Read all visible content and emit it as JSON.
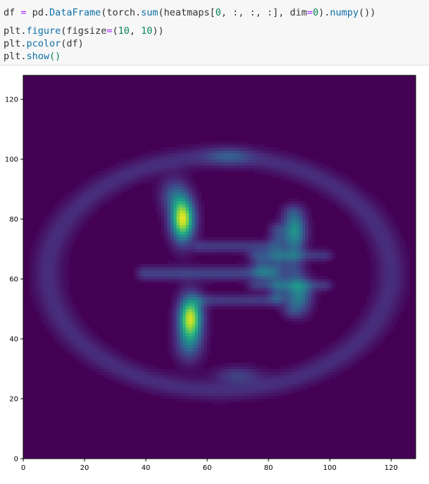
{
  "code": {
    "lines": [
      [
        {
          "t": "df ",
          "c": "def"
        },
        {
          "t": "=",
          "c": "op"
        },
        {
          "t": " pd.",
          "c": "def"
        },
        {
          "t": "DataFrame",
          "c": "fn"
        },
        {
          "t": "(torch.",
          "c": "def"
        },
        {
          "t": "sum",
          "c": "fn"
        },
        {
          "t": "(heatmaps[",
          "c": "def"
        },
        {
          "t": "0",
          "c": "num"
        },
        {
          "t": ", :, :, :], dim",
          "c": "def"
        },
        {
          "t": "=",
          "c": "op"
        },
        {
          "t": "0",
          "c": "num"
        },
        {
          "t": ").",
          "c": "def"
        },
        {
          "t": "numpy",
          "c": "fn"
        },
        {
          "t": "())",
          "c": "def"
        }
      ],
      [
        {
          "t": "plt.",
          "c": "def"
        },
        {
          "t": "figure",
          "c": "fn"
        },
        {
          "t": "(figsize",
          "c": "def"
        },
        {
          "t": "=",
          "c": "op"
        },
        {
          "t": "(",
          "c": "def"
        },
        {
          "t": "10",
          "c": "num"
        },
        {
          "t": ", ",
          "c": "def"
        },
        {
          "t": "10",
          "c": "num"
        },
        {
          "t": "))",
          "c": "def"
        }
      ],
      [
        {
          "t": "plt.",
          "c": "def"
        },
        {
          "t": "pcolor",
          "c": "fn"
        },
        {
          "t": "(df)",
          "c": "def"
        }
      ],
      [
        {
          "t": "plt.",
          "c": "def"
        },
        {
          "t": "show",
          "c": "fn"
        },
        {
          "t": "()",
          "c": "num"
        }
      ]
    ]
  },
  "colors": {
    "background": "#440154",
    "viridis": [
      "#440154",
      "#482878",
      "#3e4989",
      "#31688e",
      "#26828e",
      "#1f9e89",
      "#35b779",
      "#6ece58",
      "#b5de2b",
      "#fde725"
    ]
  },
  "chart_data": {
    "type": "heatmap",
    "title": "",
    "xlabel": "",
    "ylabel": "",
    "xlim": [
      0,
      128
    ],
    "ylim": [
      0,
      128
    ],
    "xticks": [
      "0",
      "20",
      "40",
      "60",
      "80",
      "100",
      "120"
    ],
    "yticks": [
      "0",
      "20",
      "40",
      "60",
      "80",
      "100",
      "120"
    ],
    "colormap": "viridis",
    "grid": false,
    "features": [
      {
        "kind": "ring",
        "cx": 64,
        "cy": 62,
        "rx": 56,
        "ry": 39,
        "intensity": 0.13
      },
      {
        "kind": "blob",
        "cx": 52,
        "cy": 80,
        "sx": 2.6,
        "sy": 5,
        "intensity": 0.95
      },
      {
        "kind": "blob",
        "cx": 54.5,
        "cy": 47,
        "sx": 2.6,
        "sy": 5,
        "intensity": 0.92
      },
      {
        "kind": "blob",
        "cx": 49,
        "cy": 88,
        "sx": 3,
        "sy": 4,
        "intensity": 0.25
      },
      {
        "kind": "blob",
        "cx": 54,
        "cy": 38,
        "sx": 3,
        "sy": 4,
        "intensity": 0.25
      },
      {
        "kind": "blob",
        "cx": 89,
        "cy": 76,
        "sx": 2.5,
        "sy": 4,
        "intensity": 0.3
      },
      {
        "kind": "blob",
        "cx": 91,
        "cy": 55,
        "sx": 2.5,
        "sy": 4,
        "intensity": 0.3
      },
      {
        "kind": "blob",
        "cx": 78,
        "cy": 64,
        "sx": 2.5,
        "sy": 3,
        "intensity": 0.25
      },
      {
        "kind": "blob",
        "cx": 67,
        "cy": 101,
        "sx": 5,
        "sy": 2,
        "intensity": 0.18
      },
      {
        "kind": "blob",
        "cx": 70,
        "cy": 28,
        "sx": 5,
        "sy": 2,
        "intensity": 0.18
      },
      {
        "kind": "hbar",
        "x0": 40,
        "x1": 80,
        "cy": 62,
        "s": 1.6,
        "intensity": 0.2
      },
      {
        "kind": "hbar",
        "x0": 58,
        "x1": 80,
        "cy": 71,
        "s": 1.4,
        "intensity": 0.17
      },
      {
        "kind": "hbar",
        "x0": 58,
        "x1": 82,
        "cy": 53,
        "s": 1.4,
        "intensity": 0.17
      },
      {
        "kind": "hbar",
        "x0": 76,
        "x1": 98,
        "cy": 68,
        "s": 1.3,
        "intensity": 0.16
      },
      {
        "kind": "hbar",
        "x0": 76,
        "x1": 98,
        "cy": 58,
        "s": 1.3,
        "intensity": 0.16
      },
      {
        "kind": "vbar",
        "y0": 50,
        "y1": 82,
        "cx": 88,
        "s": 2.4,
        "intensity": 0.22
      },
      {
        "kind": "vbar",
        "y0": 55,
        "y1": 76,
        "cx": 83,
        "s": 2.0,
        "intensity": 0.2
      }
    ]
  }
}
